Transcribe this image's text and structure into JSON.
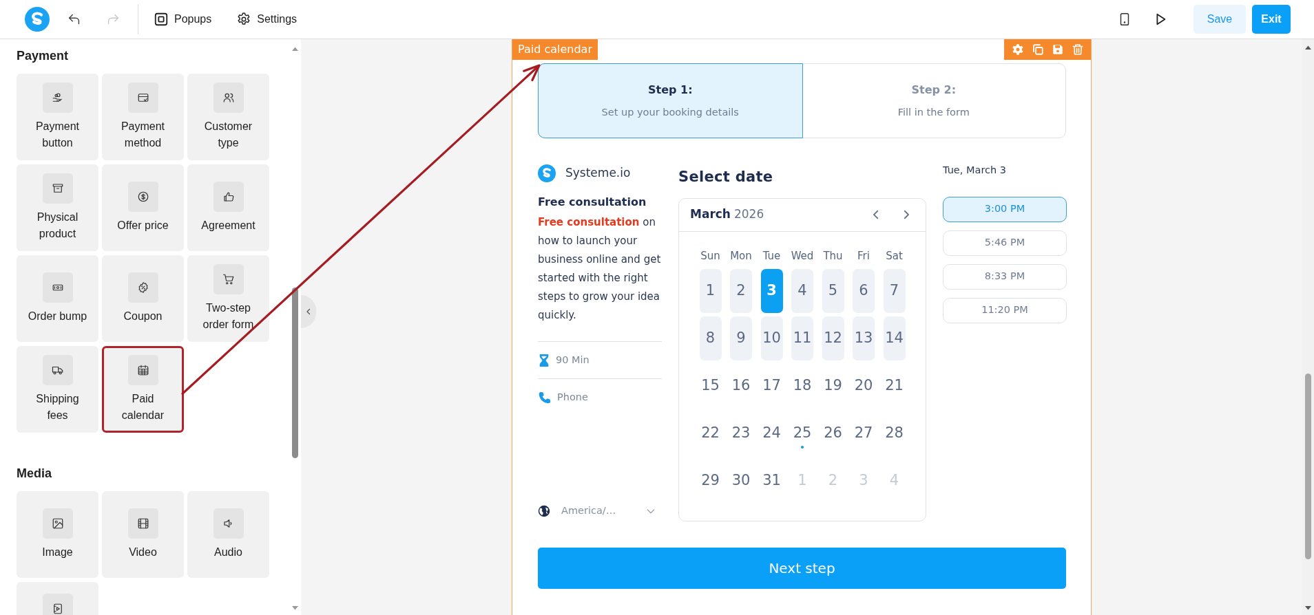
{
  "topbar": {
    "undo": {
      "disabled": false
    },
    "redo": {
      "disabled": true
    },
    "menu": [
      {
        "label": "Popups"
      },
      {
        "label": "Settings"
      }
    ],
    "save": "Save",
    "exit": "Exit"
  },
  "sidebar": {
    "sections": [
      {
        "title": "Payment",
        "items": [
          {
            "label": "Payment button",
            "highlighted": false
          },
          {
            "label": "Payment method",
            "highlighted": false
          },
          {
            "label": "Customer type",
            "highlighted": false
          },
          {
            "label": "Physical product",
            "highlighted": false
          },
          {
            "label": "Offer price",
            "highlighted": false
          },
          {
            "label": "Agreement",
            "highlighted": false
          },
          {
            "label": "Order bump",
            "highlighted": false
          },
          {
            "label": "Coupon",
            "highlighted": false
          },
          {
            "label": "Two-step order form",
            "highlighted": false
          },
          {
            "label": "Shipping fees",
            "highlighted": false
          },
          {
            "label": "Paid calendar",
            "highlighted": true
          }
        ]
      },
      {
        "title": "Media",
        "items": [
          {
            "label": "Image",
            "highlighted": false
          },
          {
            "label": "Video",
            "highlighted": false
          },
          {
            "label": "Audio",
            "highlighted": false
          },
          {
            "highlighted": false
          }
        ]
      }
    ]
  },
  "element": {
    "label": "Paid calendar",
    "steps": [
      {
        "title": "Step 1:",
        "subtitle": "Set up your booking details",
        "selected": true
      },
      {
        "title": "Step 2:",
        "subtitle": "Fill in the form",
        "selected": false
      }
    ],
    "brand": "Systeme.io",
    "event_title": "Free consultation",
    "description": "**Free consultation** on how to launch your business online and get started with the right steps to grow your idea quickly.",
    "duration": "90 Min",
    "location": "Phone",
    "timezone": "America/…",
    "calendar": {
      "heading": "Select date",
      "month": "March",
      "year": "2026",
      "weekdays": [
        "Sun",
        "Mon",
        "Tue",
        "Wed",
        "Thu",
        "Fri",
        "Sat"
      ],
      "days": [
        {
          "label": "1",
          "available": true,
          "selected": false,
          "outside": false,
          "marked": false
        },
        {
          "label": "2",
          "available": true,
          "selected": false,
          "outside": false,
          "marked": false
        },
        {
          "label": "3",
          "available": true,
          "selected": true,
          "outside": false,
          "marked": false
        },
        {
          "label": "4",
          "available": true,
          "selected": false,
          "outside": false,
          "marked": false
        },
        {
          "label": "5",
          "available": true,
          "selected": false,
          "outside": false,
          "marked": false
        },
        {
          "label": "6",
          "available": true,
          "selected": false,
          "outside": false,
          "marked": false
        },
        {
          "label": "7",
          "available": true,
          "selected": false,
          "outside": false,
          "marked": false
        },
        {
          "label": "8",
          "available": true,
          "selected": false,
          "outside": false,
          "marked": false
        },
        {
          "label": "9",
          "available": true,
          "selected": false,
          "outside": false,
          "marked": false
        },
        {
          "label": "10",
          "available": true,
          "selected": false,
          "outside": false,
          "marked": false
        },
        {
          "label": "11",
          "available": true,
          "selected": false,
          "outside": false,
          "marked": false
        },
        {
          "label": "12",
          "available": true,
          "selected": false,
          "outside": false,
          "marked": false
        },
        {
          "label": "13",
          "available": true,
          "selected": false,
          "outside": false,
          "marked": false
        },
        {
          "label": "14",
          "available": true,
          "selected": false,
          "outside": false,
          "marked": false
        },
        {
          "label": "15",
          "available": false,
          "selected": false,
          "outside": false,
          "marked": false
        },
        {
          "label": "16",
          "available": false,
          "selected": false,
          "outside": false,
          "marked": false
        },
        {
          "label": "17",
          "available": false,
          "selected": false,
          "outside": false,
          "marked": false
        },
        {
          "label": "18",
          "available": false,
          "selected": false,
          "outside": false,
          "marked": false
        },
        {
          "label": "19",
          "available": false,
          "selected": false,
          "outside": false,
          "marked": false
        },
        {
          "label": "20",
          "available": false,
          "selected": false,
          "outside": false,
          "marked": false
        },
        {
          "label": "21",
          "available": false,
          "selected": false,
          "outside": false,
          "marked": false
        },
        {
          "label": "22",
          "available": false,
          "selected": false,
          "outside": false,
          "marked": false
        },
        {
          "label": "23",
          "available": false,
          "selected": false,
          "outside": false,
          "marked": false
        },
        {
          "label": "24",
          "available": false,
          "selected": false,
          "outside": false,
          "marked": false
        },
        {
          "label": "25",
          "available": false,
          "selected": false,
          "outside": false,
          "marked": true
        },
        {
          "label": "26",
          "available": false,
          "selected": false,
          "outside": false,
          "marked": false
        },
        {
          "label": "27",
          "available": false,
          "selected": false,
          "outside": false,
          "marked": false
        },
        {
          "label": "28",
          "available": false,
          "selected": false,
          "outside": false,
          "marked": false
        },
        {
          "label": "29",
          "available": false,
          "selected": false,
          "outside": false,
          "marked": false
        },
        {
          "label": "30",
          "available": false,
          "selected": false,
          "outside": false,
          "marked": false
        },
        {
          "label": "31",
          "available": false,
          "selected": false,
          "outside": false,
          "marked": false
        },
        {
          "label": "1",
          "available": false,
          "selected": false,
          "outside": true,
          "marked": false
        },
        {
          "label": "2",
          "available": false,
          "selected": false,
          "outside": true,
          "marked": false
        },
        {
          "label": "3",
          "available": false,
          "selected": false,
          "outside": true,
          "marked": false
        },
        {
          "label": "4",
          "available": false,
          "selected": false,
          "outside": true,
          "marked": false
        }
      ]
    },
    "slots_date": "Tue, March 3",
    "slots": [
      {
        "label": "3:00 PM",
        "selected": true
      },
      {
        "label": "5:46 PM",
        "selected": false
      },
      {
        "label": "8:33 PM",
        "selected": false
      },
      {
        "label": "11:20 PM",
        "selected": false
      }
    ],
    "next_button": "Next step"
  }
}
